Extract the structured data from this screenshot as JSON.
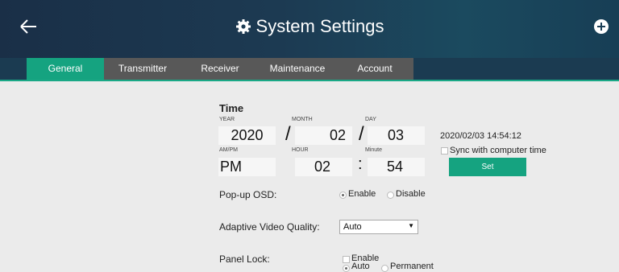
{
  "header": {
    "title": "System Settings",
    "back_icon": "arrow-left-icon",
    "gear_icon": "gear-icon",
    "add_icon": "plus-circle-icon"
  },
  "tabs": [
    {
      "label": "General",
      "active": true
    },
    {
      "label": "Transmitter"
    },
    {
      "label": "Receiver"
    },
    {
      "label": "Maintenance"
    },
    {
      "label": "Account"
    }
  ],
  "time": {
    "section_title": "Time",
    "year_label": "YEAR",
    "month_label": "MONTH",
    "day_label": "DAY",
    "year": "2020",
    "month": "02",
    "day": "03",
    "ampm_label": "AM/PM",
    "hour_label": "HOUR",
    "minute_label": "Minute",
    "ampm": "PM",
    "hour": "02",
    "minute": "54",
    "date_sep": "/",
    "time_sep": ":",
    "current_datetime": "2020/02/03 14:54:12",
    "sync_label": "Sync with computer time",
    "set_button": "Set"
  },
  "osd": {
    "label": "Pop-up OSD:",
    "enable": "Enable",
    "disable": "Disable",
    "selected": "Enable"
  },
  "video_quality": {
    "label": "Adaptive Video Quality:",
    "value": "Auto"
  },
  "panel_lock": {
    "label": "Panel Lock:",
    "enable": "Enable",
    "auto": "Auto",
    "permanent": "Permanent",
    "selected": "Auto"
  },
  "colors": {
    "accent": "#15a380",
    "header": "#1b3b51",
    "tab_inactive": "#585858",
    "background": "#ebebeb"
  }
}
